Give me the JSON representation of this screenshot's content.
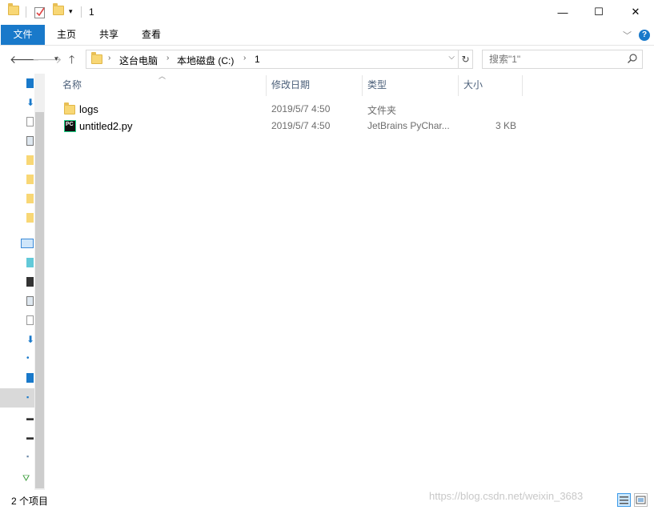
{
  "window": {
    "title": "1",
    "minimize": "—",
    "maximize": "☐",
    "close": "✕"
  },
  "ribbon": {
    "tabs": [
      {
        "label": "文件"
      },
      {
        "label": "主页"
      },
      {
        "label": "共享"
      },
      {
        "label": "查看"
      }
    ],
    "help": "?"
  },
  "address": {
    "crumbs": [
      "这台电脑",
      "本地磁盘 (C:)",
      "1"
    ]
  },
  "search": {
    "placeholder": "搜索\"1\""
  },
  "columns": [
    "名称",
    "修改日期",
    "类型",
    "大小"
  ],
  "files": [
    {
      "name": "logs",
      "date": "2019/5/7 4:50",
      "type": "文件夹",
      "size": "",
      "icon": "folder-icon"
    },
    {
      "name": "untitled2.py",
      "date": "2019/5/7 4:50",
      "type": "JetBrains PyChar...",
      "size": "3 KB",
      "icon": "pycharm-file-icon"
    }
  ],
  "status": {
    "count": "2 个项目"
  },
  "watermark": "https://blog.csdn.net/weixin_3683",
  "colors": {
    "accent": "#1979ca",
    "header_text": "#4c607a",
    "folder": "#f8d775"
  }
}
